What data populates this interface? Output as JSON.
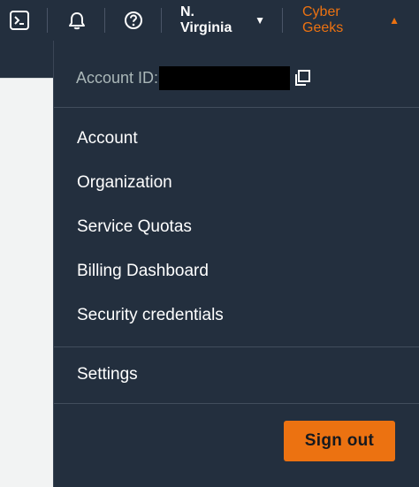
{
  "topbar": {
    "icons": {
      "cloudshell": "cloudshell-icon",
      "notifications": "bell-icon",
      "help": "help-circle-icon"
    },
    "region": "N. Virginia",
    "account_name": "Cyber Geeks",
    "accent_color": "#ec7211",
    "background_color": "#232f3e"
  },
  "dropdown": {
    "account_id_label": "Account ID:",
    "menu_items": [
      "Account",
      "Organization",
      "Service Quotas",
      "Billing Dashboard",
      "Security credentials"
    ],
    "settings_label": "Settings",
    "sign_out_label": "Sign out"
  }
}
